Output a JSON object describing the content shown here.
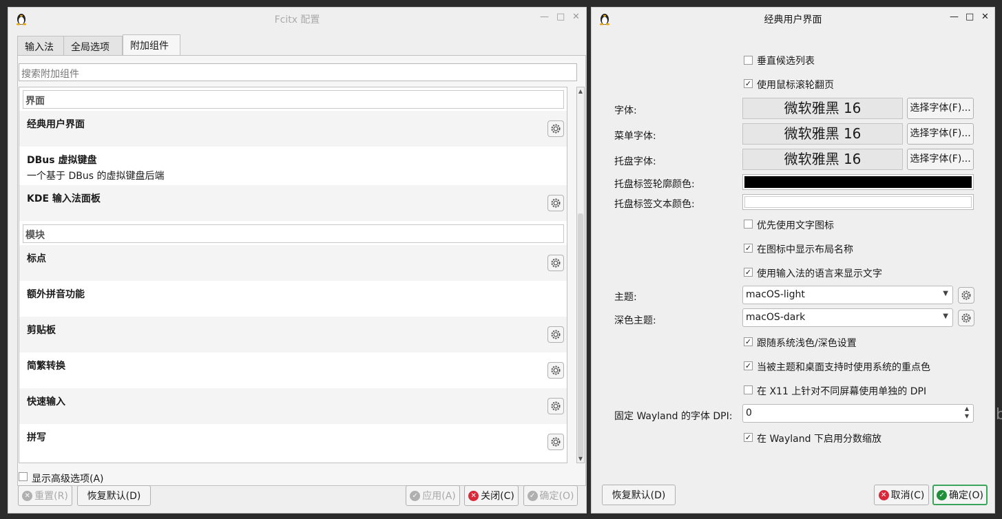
{
  "left_window": {
    "title": "Fcitx 配置",
    "tabs": [
      "输入法",
      "全局选项",
      "附加组件"
    ],
    "active_tab": "附加组件",
    "search_placeholder": "搜索附加组件",
    "sections": [
      {
        "header": "界面",
        "items": [
          {
            "title": "经典用户界面",
            "desc": "",
            "configurable": true
          },
          {
            "title": "DBus 虚拟键盘",
            "desc": "一个基于 DBus 的虚拟键盘后端",
            "configurable": false
          },
          {
            "title": "KDE 输入法面板",
            "desc": "",
            "configurable": true
          }
        ]
      },
      {
        "header": "模块",
        "items": [
          {
            "title": "标点",
            "desc": "",
            "configurable": true
          },
          {
            "title": "额外拼音功能",
            "desc": "",
            "configurable": false
          },
          {
            "title": "剪贴板",
            "desc": "",
            "configurable": true
          },
          {
            "title": "简繁转换",
            "desc": "",
            "configurable": true
          },
          {
            "title": "快速输入",
            "desc": "",
            "configurable": true
          },
          {
            "title": "拼写",
            "desc": "",
            "configurable": true
          }
        ]
      }
    ],
    "show_advanced": {
      "label": "显示高级选项(A)",
      "checked": false
    },
    "buttons": {
      "reset": "重置(R)",
      "restore_default": "恢复默认(D)",
      "apply": "应用(A)",
      "close": "关闭(C)",
      "ok": "确定(O)"
    }
  },
  "right_window": {
    "title": "经典用户界面",
    "vertical_candidate": {
      "label": "垂直候选列表",
      "checked": false
    },
    "wheel_page": {
      "label": "使用鼠标滚轮翻页",
      "checked": true
    },
    "font": {
      "label": "字体:",
      "value": "微软雅黑 16",
      "button": "选择字体(F)..."
    },
    "menu_font": {
      "label": "菜单字体:",
      "value": "微软雅黑 16",
      "button": "选择字体(F)..."
    },
    "tray_font": {
      "label": "托盘字体:",
      "value": "微软雅黑 16",
      "button": "选择字体(F)..."
    },
    "tray_outline_color": {
      "label": "托盘标签轮廓颜色:",
      "color": "#000000"
    },
    "tray_text_color": {
      "label": "托盘标签文本颜色:",
      "color": "#ffffff"
    },
    "prefer_text_icon": {
      "label": "优先使用文字图标",
      "checked": false
    },
    "show_layout_name": {
      "label": "在图标中显示布局名称",
      "checked": true
    },
    "use_im_language": {
      "label": "使用输入法的语言来显示文字",
      "checked": true
    },
    "theme": {
      "label": "主题:",
      "value": "macOS-light"
    },
    "dark_theme": {
      "label": "深色主题:",
      "value": "macOS-dark"
    },
    "follow_system": {
      "label": "跟随系统浅色/深色设置",
      "checked": true
    },
    "accent_color": {
      "label": "当被主题和桌面支持时使用系统的重点色",
      "checked": true
    },
    "per_screen_dpi": {
      "label": "在 X11 上针对不同屏幕使用单独的 DPI",
      "checked": false
    },
    "wayland_dpi": {
      "label": "固定 Wayland 的字体 DPI:",
      "value": "0"
    },
    "fractional_scale": {
      "label": "在 Wayland 下启用分数缩放",
      "checked": true
    },
    "buttons": {
      "restore_default": "恢复默认(D)",
      "cancel": "取消(C)",
      "ok": "确定(O)"
    }
  },
  "colors": {
    "cancel_icon": "#d9283a",
    "ok_icon": "#1f8f3a",
    "disabled_icon": "#b0b0b0"
  }
}
